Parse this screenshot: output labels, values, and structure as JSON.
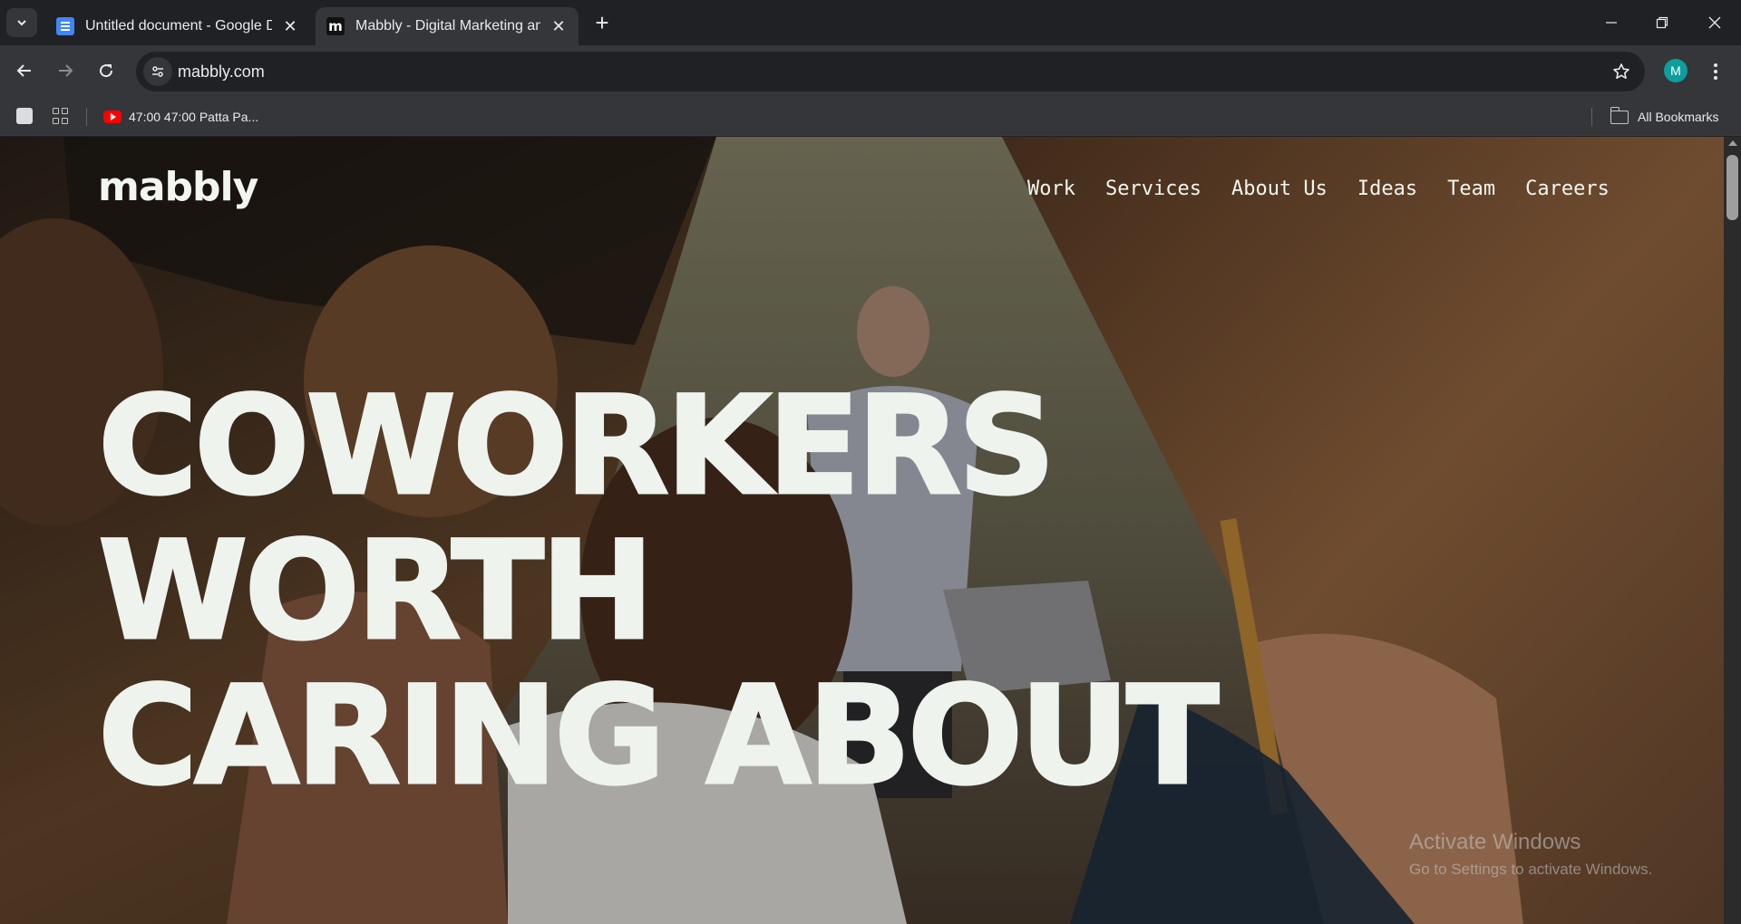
{
  "browser": {
    "tabs": [
      {
        "title": "Untitled document - Google Docs",
        "favicon": "google-docs-icon",
        "active": false
      },
      {
        "title": "Mabbly - Digital Marketing and",
        "favicon": "mabbly-m-icon",
        "active": true
      }
    ],
    "new_tab_label": "+",
    "address": "mabbly.com",
    "profile_initial": "M",
    "profile_color": "#0f9d9d"
  },
  "bookmarks": {
    "items": [
      {
        "label": "47:00 47:00 Patta Pa...",
        "icon": "youtube-icon"
      }
    ],
    "all_bookmarks_label": "All Bookmarks"
  },
  "site": {
    "logo": "mabbly",
    "nav": [
      "Work",
      "Services",
      "About Us",
      "Ideas",
      "Team",
      "Careers"
    ],
    "headline": [
      "COWORKERS",
      "WORTH",
      "CARING ABOUT"
    ],
    "text_color": "#eef3ee"
  },
  "os_watermark": {
    "title": "Activate Windows",
    "subtitle": "Go to Settings to activate Windows."
  }
}
